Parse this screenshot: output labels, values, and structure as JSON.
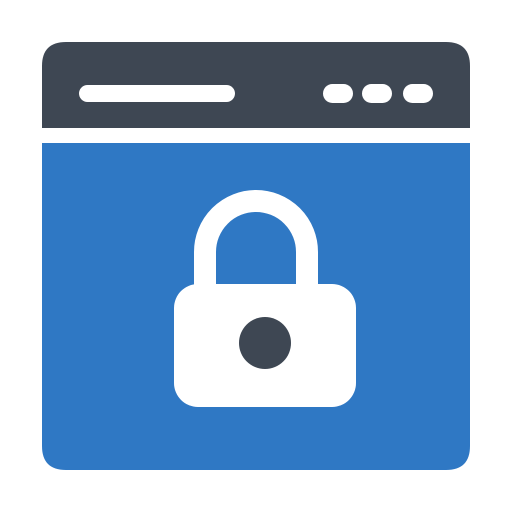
{
  "icon": {
    "name": "secure-browser-window-icon",
    "colors": {
      "frame": "#3e4753",
      "content": "#2f78c4",
      "lock": "#ffffff",
      "keyhole": "#3e4753",
      "background": "#ffffff"
    }
  }
}
